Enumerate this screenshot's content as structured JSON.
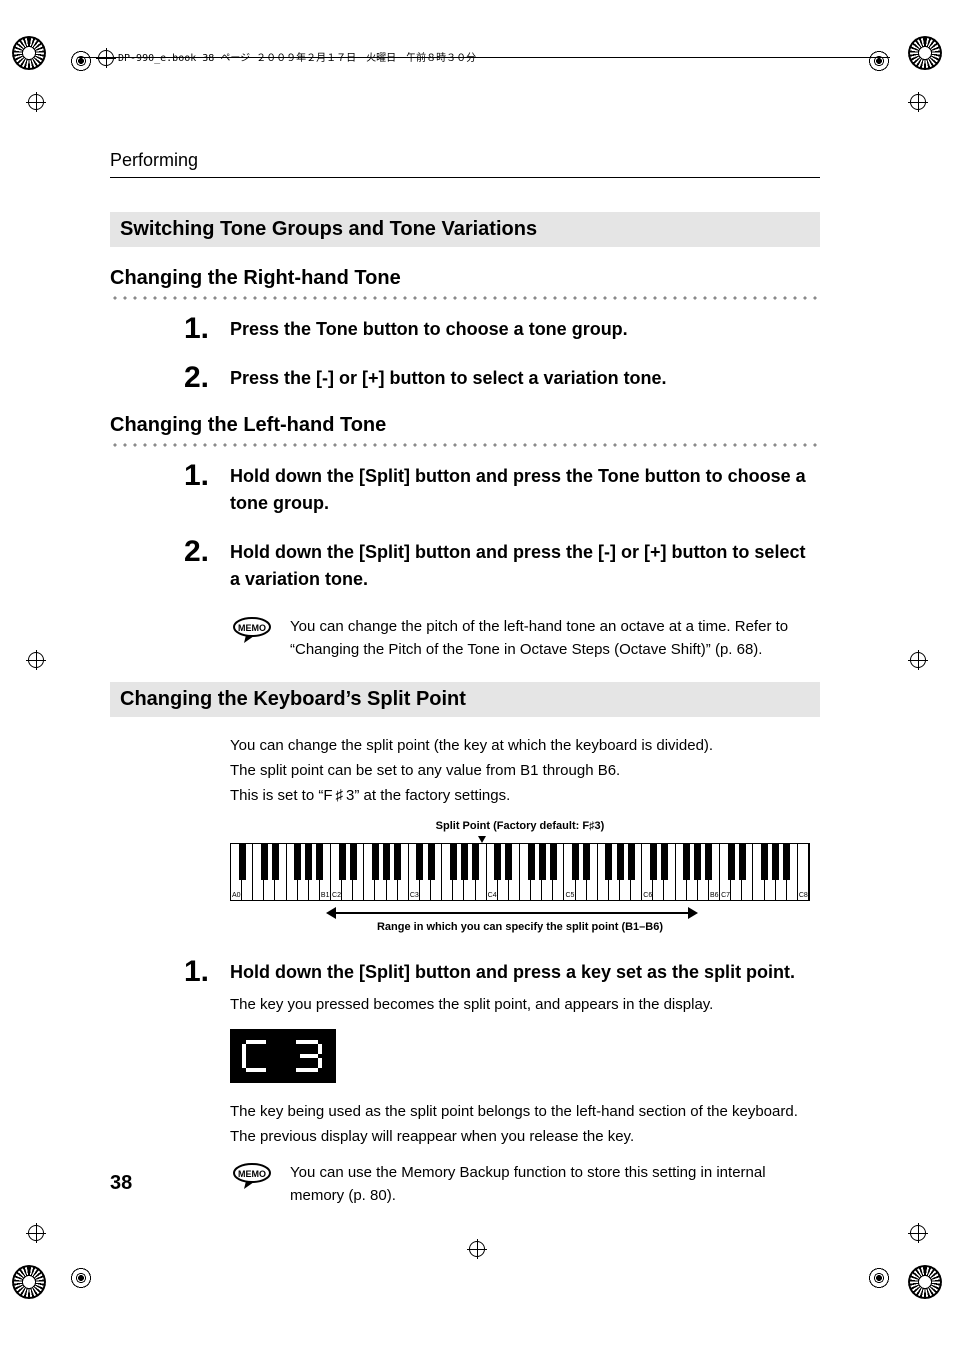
{
  "trim_note": "DP-990_e.book 38 ページ ２００９年２月１７日　火曜日　午前８時３０分",
  "running_head": "Performing",
  "page_number": "38",
  "h_bar_1": "Switching Tone Groups and Tone Variations",
  "sub1": "Changing the Right-hand Tone",
  "steps_right": [
    "Press the Tone button to choose a tone group.",
    "Press the [-] or [+] button to select a variation tone."
  ],
  "sub2": "Changing the Left-hand Tone",
  "steps_left": [
    "Hold down the [Split] button and press the Tone button to choose a tone group.",
    "Hold down the [Split] button and press the [-] or [+] button to select a variation tone."
  ],
  "memo1": "You can change the pitch of the left-hand tone an octave at a time. Refer to “Changing the Pitch of the Tone in Octave Steps (Octave Shift)” (p. 68).",
  "h_bar_2": "Changing the Keyboard’s Split Point",
  "body1_lines": [
    "You can change the split point (the key at which the keyboard is divided).",
    "The split point can be set to any value from B1 through B6.",
    "This is set to “F ♯ 3” at the factory settings."
  ],
  "kbd": {
    "caption_top": "Split Point (Factory default: F♯3)",
    "caption_bottom": "Range in which you can specify the split point (B1–B6)",
    "labels": [
      "A0",
      "B1",
      "C2",
      "C3",
      "C4",
      "C5",
      "C6",
      "B6",
      "C7",
      "C8"
    ],
    "range": {
      "from": "B1",
      "to": "B6"
    },
    "pointer": "F#3"
  },
  "steps_split": [
    "Hold down the [Split] button and press a key set as the split point."
  ],
  "split_after": "The key you pressed becomes the split point, and appears in the display.",
  "display_value": "C 3",
  "body2_lines": [
    "The key being used as the split point belongs to the left-hand section of the keyboard.",
    "The previous display will reappear when you release the key."
  ],
  "memo2": "You can use the Memory Backup function to store this setting in internal memory (p. 80)."
}
